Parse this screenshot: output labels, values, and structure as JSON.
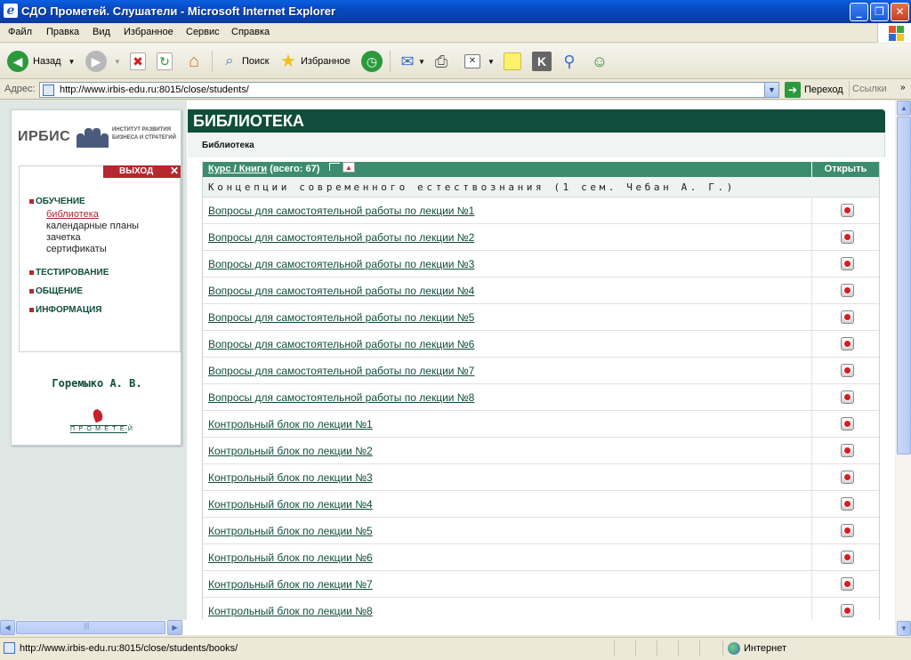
{
  "window": {
    "title": "СДО Прометей. Слушатели - Microsoft Internet Explorer"
  },
  "menu": [
    "Файл",
    "Правка",
    "Вид",
    "Избранное",
    "Сервис",
    "Справка"
  ],
  "toolbar": {
    "back_label": "Назад",
    "search_label": "Поиск",
    "favorites_label": "Избранное"
  },
  "address": {
    "label": "Адрес:",
    "url": "http://www.irbis-edu.ru:8015/close/students/",
    "go_label": "Переход",
    "links_label": "Ссылки"
  },
  "sidebar": {
    "logo_text": "ИРБИС",
    "institute": [
      "ИНСТИТУТ РАЗВИТИЯ",
      "БИЗНЕСА И СТРАТЕГИЙ"
    ],
    "exit_label": "ВЫХОД",
    "sections": [
      {
        "label": "ОБУЧЕНИЕ",
        "items": [
          "библиотека",
          "календарные планы",
          "зачетка",
          "сертификаты"
        ],
        "active_item": "библиотека"
      },
      {
        "label": "ТЕСТИРОВАНИЕ"
      },
      {
        "label": "ОБЩЕНИЕ"
      },
      {
        "label": "ИНФОРМАЦИЯ"
      }
    ],
    "user_name": "Горемыко А. В.",
    "prometey_label": "П·Р·О·М·Е·Т·Е·Й"
  },
  "main": {
    "title": "БИБЛИОТЕКА",
    "breadcrumb": "Библиотека",
    "table": {
      "header_link": "Курс / Книги",
      "header_count": "(всего: 67)",
      "open_col": "Открыть",
      "course": "Концепции современного естествознания (1 сем. Чебан А. Г.)",
      "items": [
        "Вопросы для самостоятельной работы по лекции №1",
        "Вопросы для самостоятельной работы по лекции №2",
        "Вопросы для самостоятельной работы по лекции №3",
        "Вопросы для самостоятельной работы по лекции №4",
        "Вопросы для самостоятельной работы по лекции №5",
        "Вопросы для самостоятельной работы по лекции №6",
        "Вопросы для самостоятельной работы по лекции №7",
        "Вопросы для самостоятельной работы по лекции №8",
        "Контрольный блок по лекции №1",
        "Контрольный блок по лекции №2",
        "Контрольный блок по лекции №3",
        "Контрольный блок по лекции №4",
        "Контрольный блок по лекции №5",
        "Контрольный блок по лекции №6",
        "Контрольный блок по лекции №7",
        "Контрольный блок по лекции №8"
      ]
    }
  },
  "status": {
    "text": "http://www.irbis-edu.ru:8015/close/students/books/",
    "zone": "Интернет"
  },
  "colors": {
    "brand_green": "#0f4e3a",
    "table_header": "#3c8c6e",
    "accent_red": "#b4282e"
  }
}
